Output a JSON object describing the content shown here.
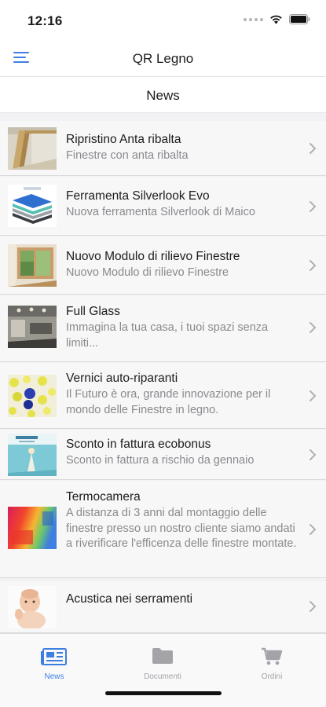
{
  "status_bar": {
    "time": "12:16",
    "icons": [
      "signal-dots",
      "wifi-icon",
      "battery-icon"
    ]
  },
  "nav": {
    "title": "QR Legno",
    "menu_icon": "hamburger-menu-icon"
  },
  "section": {
    "title": "News"
  },
  "news": [
    {
      "title": "Ripristino  Anta ribalta",
      "subtitle": "Finestre con anta ribalta",
      "thumb": "window-frame"
    },
    {
      "title": "Ferramenta Silverlook Evo",
      "subtitle": "Nuova ferramenta Silverlook di Maico",
      "thumb": "hardware-layers"
    },
    {
      "title": "Nuovo Modulo di rilievo Finestre",
      "subtitle": "Nuovo Modulo di rilievo Finestre",
      "thumb": "wood-window"
    },
    {
      "title": "Full Glass",
      "subtitle": "Immagina la tua casa, i tuoi spazi senza limiti...",
      "thumb": "interior"
    },
    {
      "title": "Vernici auto-riparanti",
      "subtitle": "Il Futuro è ora, grande innovazione per il mondo delle Finestre in legno.",
      "thumb": "spheres"
    },
    {
      "title": "Sconto in fattura ecobonus",
      "subtitle": "Sconto in fattura a rischio da gennaio",
      "thumb": "ecobonus"
    },
    {
      "title": "Termocamera",
      "subtitle": "A distanza di 3 anni dal montaggio delle finestre presso un nostro cliente siamo andati a riverificare l'efficenza delle finestre montate.",
      "thumb": "thermal"
    },
    {
      "title": "Acustica nei serramenti",
      "subtitle": "",
      "thumb": "baby"
    }
  ],
  "tabs": [
    {
      "label": "News",
      "icon": "newspaper-icon",
      "active": true
    },
    {
      "label": "Documenti",
      "icon": "folder-icon",
      "active": false
    },
    {
      "label": "Ordini",
      "icon": "cart-icon",
      "active": false
    }
  ],
  "colors": {
    "accent": "#3d7fe0",
    "inactive": "#a3a3a8",
    "list_bg": "#f2f2f4"
  }
}
